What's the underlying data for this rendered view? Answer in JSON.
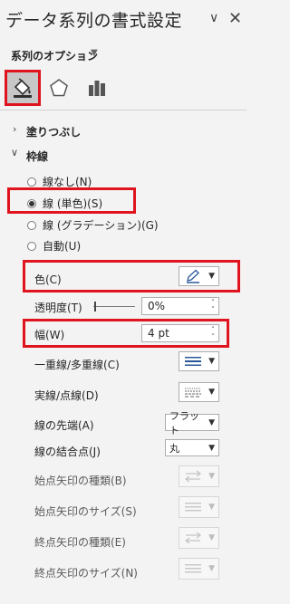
{
  "pane": {
    "title": "データ系列の書式設定",
    "title_chevron": "∨",
    "close": "✕",
    "series_options": "系列のオプション",
    "series_options_chevron": "▼"
  },
  "icons": {
    "fill_tab": "paint-bucket-icon",
    "effects_tab": "pentagon-icon",
    "series_tab": "bar-chart-icon"
  },
  "sections": {
    "fill": "塗りつぶし",
    "line": "枠線",
    "fill_chevron": "›",
    "line_chevron": "∨"
  },
  "line_options": [
    {
      "label": "線なし(N)",
      "selected": false
    },
    {
      "label": "線 (単色)(S)",
      "selected": true
    },
    {
      "label": "線 (グラデーション)(G)",
      "selected": false
    },
    {
      "label": "自動(U)",
      "selected": false
    }
  ],
  "props": {
    "color": "色(C)",
    "transparency": "透明度(T)",
    "transparency_value": "0%",
    "width": "幅(W)",
    "width_value": "4 pt",
    "compound": "一重線/多重線(C)",
    "dash": "実線/点線(D)",
    "cap": "線の先端(A)",
    "cap_value": "フラット",
    "join": "線の結合点(J)",
    "join_value": "丸",
    "begin_arrow_type": "始点矢印の種類(B)",
    "begin_arrow_size": "始点矢印のサイズ(S)",
    "end_arrow_type": "終点矢印の種類(E)",
    "end_arrow_size": "終点矢印のサイズ(N)"
  },
  "colors": {
    "highlight": "#e0141e",
    "pane_bg": "#f3f3f3",
    "pen_blue": "#2b579a"
  }
}
